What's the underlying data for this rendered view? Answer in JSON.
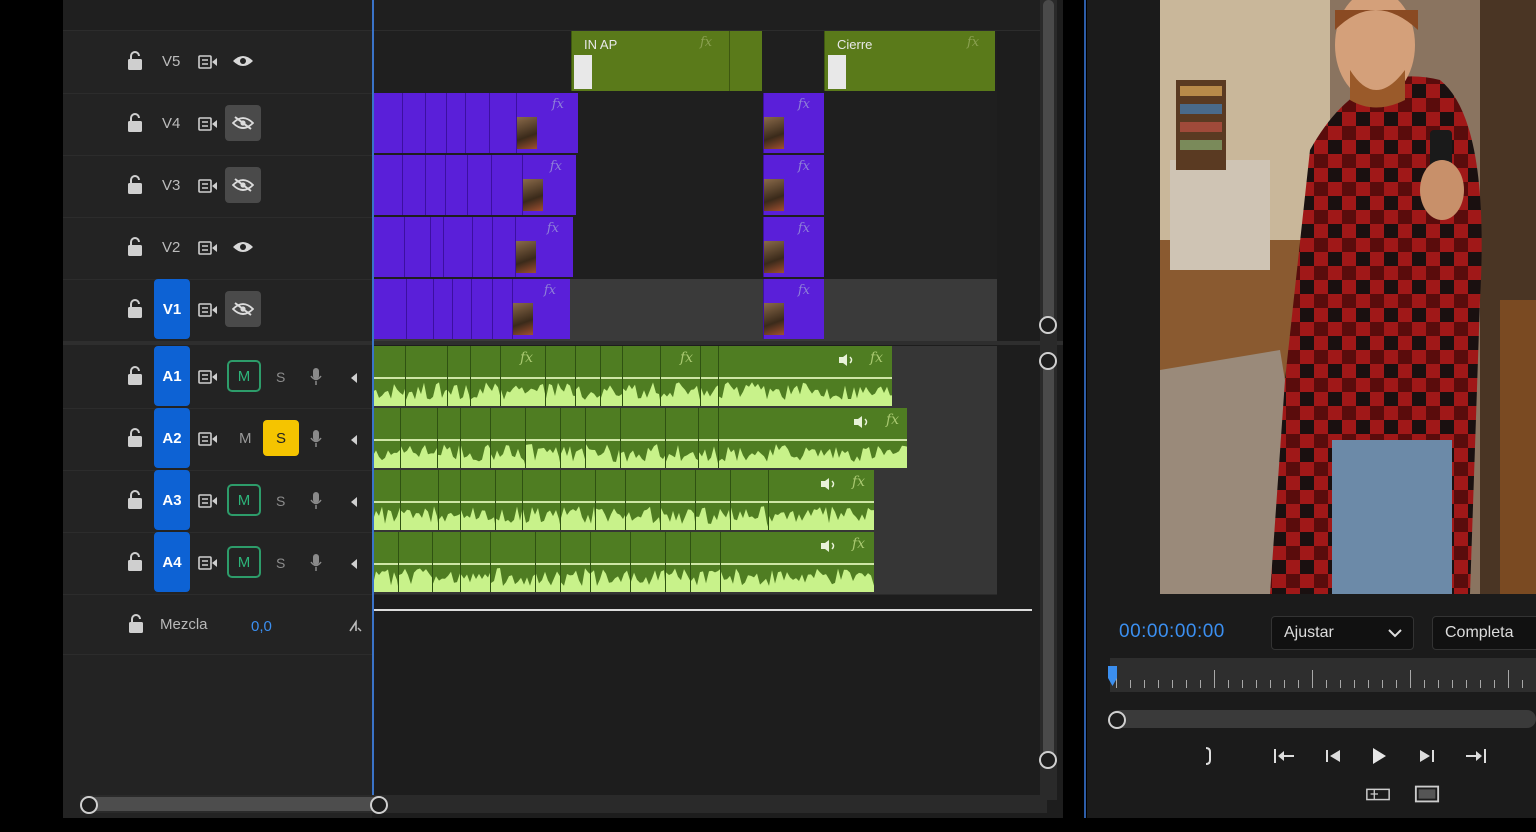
{
  "timeline": {
    "video_tracks": [
      {
        "name": "V5",
        "targeted": false,
        "visible": true
      },
      {
        "name": "V4",
        "targeted": false,
        "visible": false
      },
      {
        "name": "V3",
        "targeted": false,
        "visible": false
      },
      {
        "name": "V2",
        "targeted": false,
        "visible": true
      },
      {
        "name": "V1",
        "targeted": true,
        "visible": false
      }
    ],
    "audio_tracks": [
      {
        "name": "A1",
        "mute_label": "M",
        "mute_on": true,
        "solo_label": "S",
        "solo_on": false
      },
      {
        "name": "A2",
        "mute_label": "M",
        "mute_on": false,
        "solo_label": "S",
        "solo_on": true
      },
      {
        "name": "A3",
        "mute_label": "M",
        "mute_on": true,
        "solo_label": "S",
        "solo_on": false
      },
      {
        "name": "A4",
        "mute_label": "M",
        "mute_on": true,
        "solo_label": "S",
        "solo_on": false
      }
    ],
    "mix": {
      "label": "Mezcla",
      "value": "0,0"
    },
    "graphic_clips": [
      {
        "label": "IN AP"
      },
      {
        "label": "Cierre"
      }
    ],
    "fx_label": "fx"
  },
  "monitor": {
    "timecode": "00:00:00:00",
    "fit_select": "Ajustar",
    "quality_select": "Completa"
  },
  "colors": {
    "video_clip": "#5a1fd9",
    "graphic_clip": "#5a7a1a",
    "audio_clip": "#4f7d22",
    "target_blue": "#0d62d4",
    "solo_yellow": "#f5c400",
    "timecode_blue": "#3b8ff0"
  }
}
